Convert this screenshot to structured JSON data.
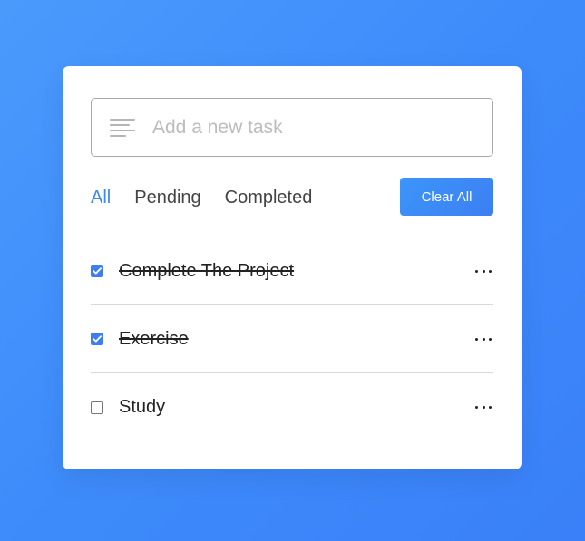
{
  "input": {
    "placeholder": "Add a new task",
    "value": "",
    "icon": "text-align-left-icon"
  },
  "filters": [
    {
      "label": "All",
      "active": true
    },
    {
      "label": "Pending",
      "active": false
    },
    {
      "label": "Completed",
      "active": false
    }
  ],
  "clear_button": {
    "label": "Clear All"
  },
  "tasks": [
    {
      "label": "Complete The Project",
      "checked": true
    },
    {
      "label": "Exercise",
      "checked": true
    },
    {
      "label": "Study",
      "checked": false
    }
  ],
  "colors": {
    "accent": "#3c87f7",
    "background_gradient_start": "#4a9afc",
    "background_gradient_end": "#3a80f8",
    "checkbox_checked": "#3d7ff0"
  }
}
